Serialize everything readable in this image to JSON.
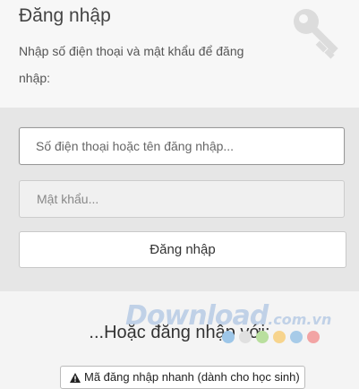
{
  "header": {
    "title": "Đăng nhập",
    "subtitle": "Nhập số điện thoại và mật khẩu để đăng nhập:",
    "icon": "key-icon"
  },
  "form": {
    "phone_placeholder": "Số điện thoại hoặc tên đăng nhập...",
    "password_placeholder": "Mật khẩu...",
    "login_label": "Đăng nhập"
  },
  "alt": {
    "label": "...Hoặc đăng nhập với:",
    "quick_login_label": "Mã đăng nhập nhanh (dành cho học sinh)",
    "quick_login_icon": "warning-icon"
  },
  "watermark": {
    "text": "Download",
    "suffix": ".com.vn",
    "dot_colors": [
      "#9dc6e8",
      "#e0e0e0",
      "#b9df9e",
      "#f7d48d",
      "#a7cbe8",
      "#f2a4a4"
    ]
  },
  "colors": {
    "header_bg": "#f7f7f7",
    "form_bg": "#e6e6e6",
    "alt_bg": "#f4f4f4"
  }
}
